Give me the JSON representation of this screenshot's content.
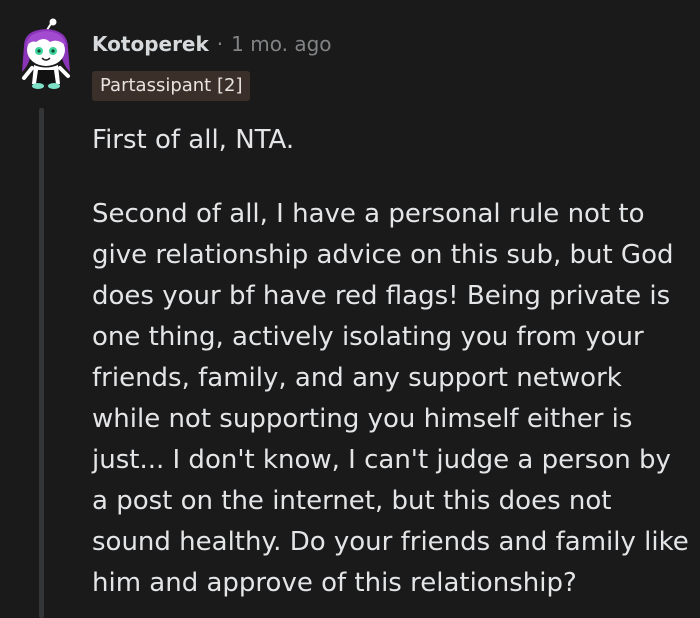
{
  "comment": {
    "username": "Kotoperek",
    "separator": "·",
    "timestamp": "1 mo. ago",
    "flair": "Partassipant [2]",
    "paragraphs": [
      "First of all, NTA.",
      "Second of all, I have a personal rule not to give relationship advice on this sub, but God does your bf have red flags! Being private is one thing, actively isolating you from your friends, family, and any support network while not supporting you himself either is just... I don't know, I can't judge a person by a post on the internet, but this does not sound healthy. Do your friends and family like him and approve of this relationship?"
    ]
  },
  "colors": {
    "background": "#1a1a1b",
    "text": "#e3e5e7",
    "meta_text": "#818384",
    "flair_bg": "#3b2f2a",
    "thread_line": "#343536",
    "avatar_hair": "#9b3fc4"
  },
  "icons": {
    "avatar": "snoo-avatar-purple-hair"
  }
}
